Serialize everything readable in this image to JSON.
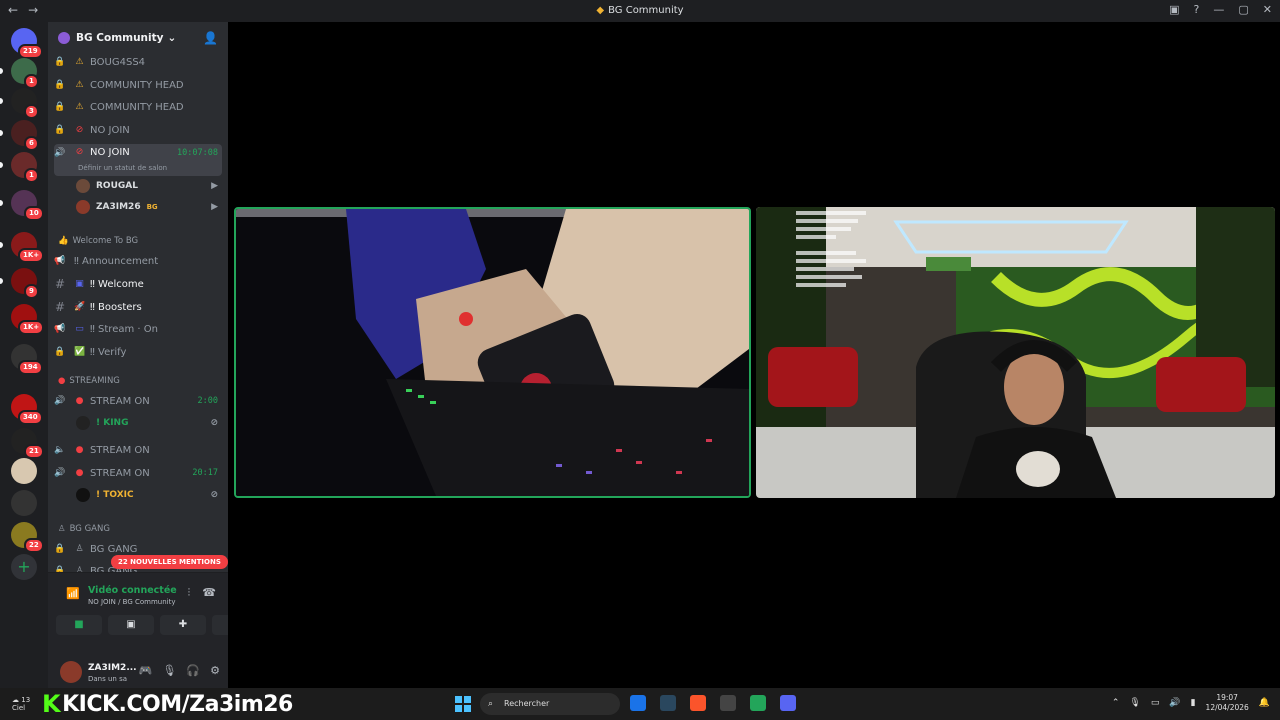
{
  "window": {
    "title": "BG Community",
    "nav_back": "←",
    "nav_fwd": "→",
    "ctrl_min": "—",
    "ctrl_max": "▢",
    "ctrl_close": "✕"
  },
  "servers": [
    {
      "name": "discord-home",
      "badge": "219",
      "color": "#5865f2"
    },
    {
      "name": "server-1",
      "badge": "1",
      "color": "#3d6b4a"
    },
    {
      "name": "server-2",
      "badge": "3",
      "color": "#222"
    },
    {
      "name": "server-3",
      "badge": "6",
      "color": "#4a2020"
    },
    {
      "name": "server-4",
      "badge": "1",
      "color": "#6a2a2a"
    },
    {
      "name": "server-5",
      "badge": "10",
      "color": "#553355"
    },
    {
      "name": "server-6",
      "badge": "1K+",
      "color": "#8a1a1a"
    },
    {
      "name": "server-7",
      "badge": "9",
      "color": "#7a1010"
    },
    {
      "name": "server-8",
      "badge": "1K+",
      "color": "#a01010"
    },
    {
      "name": "server-9",
      "badge": "194",
      "color": "#333"
    },
    {
      "name": "server-10",
      "badge": "340",
      "color": "#c01515"
    },
    {
      "name": "server-11",
      "badge": "21",
      "color": "#222"
    },
    {
      "name": "server-12",
      "badge": "",
      "color": "#d8c8b0"
    },
    {
      "name": "server-13",
      "badge": "",
      "color": "#333"
    },
    {
      "name": "server-14",
      "badge": "22",
      "color": "#8a7a20"
    }
  ],
  "guild": {
    "name": "BG Community",
    "chevron": "⌄"
  },
  "channels": {
    "c1": "BOUG4SS4",
    "c2": "COMMUNITY HEAD",
    "c3": "COMMUNITY HEAD",
    "c4": "NO JOIN",
    "c5": "NO JOIN",
    "c5_time": "10:07:08",
    "c5_status": "Définir un statut de salon",
    "u1": "ROUGAL",
    "u2": "ZA3IM26",
    "u2_tag": "BG",
    "cat1": "Welcome To BG",
    "w1": "‼ Announcement",
    "w2": "‼ Welcome",
    "w3": "‼ Boosters",
    "w4": "‼ Stream · On",
    "w5": "‼ Verify",
    "cat2": "STREAMING",
    "s1": "STREAM ON",
    "s1_time": "2:00",
    "s1_user": "! KING",
    "s2": "STREAM ON",
    "s3": "STREAM ON",
    "s3_time": "20:17",
    "s3_user": "! TOXIC",
    "cat3": "BG GANG",
    "g1": "BG GANG",
    "g2": "BG GANG"
  },
  "mentions": "22 NOUVELLES MENTIONS",
  "voice": {
    "status": "Vidéo connectée",
    "location": "NO JOIN / BG Community"
  },
  "user": {
    "name": "ZA3IM2...",
    "status": "Dans un sa"
  },
  "taskbar": {
    "overlay": "KICK.COM/Za3im26",
    "weather_temp": "13",
    "weather_sub": "Ciel",
    "search": "Rechercher",
    "time": "19:07",
    "date": "12/04/2026"
  },
  "colors": {
    "accent_green": "#23a55a",
    "mention_red": "#f23f43",
    "kick_green": "#53fc18"
  }
}
